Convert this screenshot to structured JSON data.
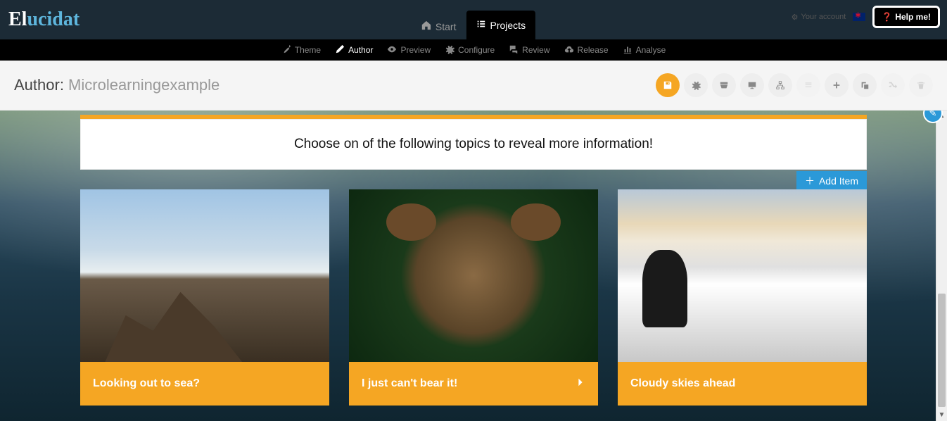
{
  "header": {
    "logo": "Elucidat",
    "your_account": "Your account",
    "help_me": "Help me!",
    "nav": {
      "start": "Start",
      "projects": "Projects"
    }
  },
  "subnav": {
    "theme": "Theme",
    "author": "Author",
    "preview": "Preview",
    "configure": "Configure",
    "review": "Review",
    "release": "Release",
    "analyse": "Analyse"
  },
  "page": {
    "title_prefix": "Author: ",
    "project_name": "Microlearningexample"
  },
  "content": {
    "instruction": "Choose on of the following topics to reveal more information!",
    "add_item": "Add Item",
    "cards": [
      {
        "caption": "Looking out to sea?"
      },
      {
        "caption": "I just can't bear it!"
      },
      {
        "caption": "Cloudy skies ahead"
      }
    ]
  }
}
